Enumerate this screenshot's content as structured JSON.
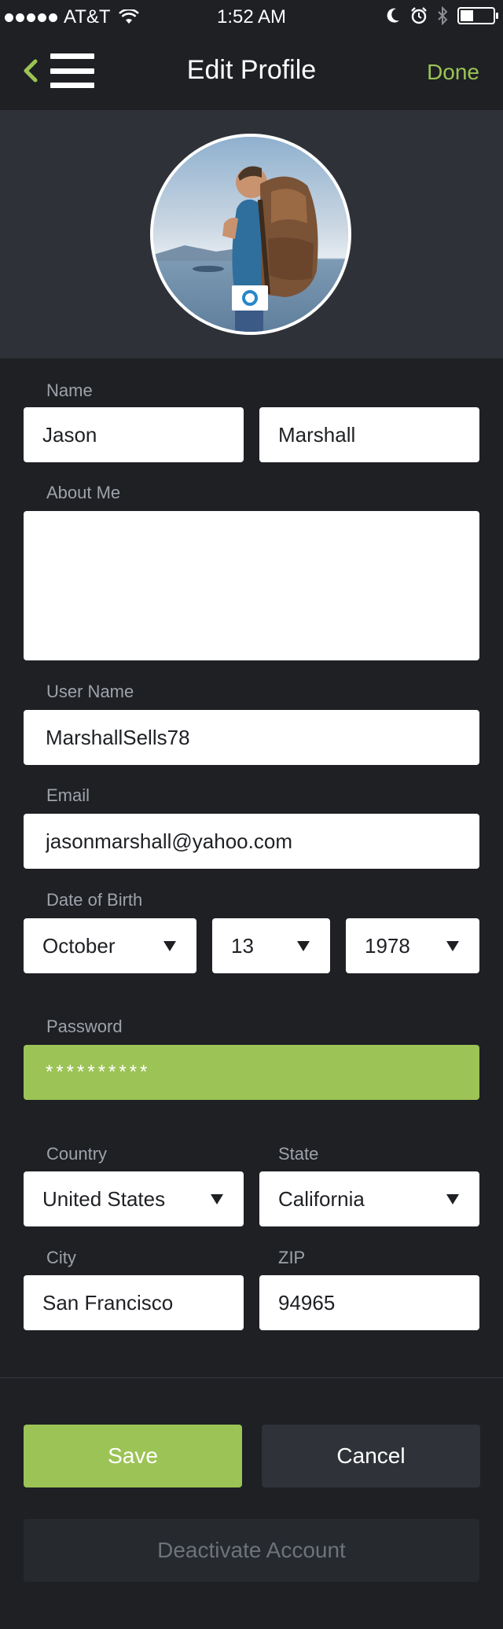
{
  "status_bar": {
    "carrier": "AT&T",
    "time": "1:52 AM"
  },
  "nav": {
    "title": "Edit Profile",
    "done_label": "Done"
  },
  "form": {
    "name_label": "Name",
    "first_name": "Jason",
    "last_name": "Marshall",
    "about_label": "About Me",
    "about_value": "",
    "username_label": "User Name",
    "username": "MarshallSells78",
    "email_label": "Email",
    "email": "jasonmarshall@yahoo.com",
    "dob_label": "Date of Birth",
    "dob_month": "October",
    "dob_day": "13",
    "dob_year": "1978",
    "password_label": "Password",
    "password_masked": "**********",
    "country_label": "Country",
    "country": "United States",
    "state_label": "State",
    "state": "California",
    "city_label": "City",
    "city": "San Francisco",
    "zip_label": "ZIP",
    "zip": "94965"
  },
  "actions": {
    "save_label": "Save",
    "cancel_label": "Cancel",
    "deactivate_label": "Deactivate Account"
  },
  "colors": {
    "accent": "#9cc355",
    "background": "#1e2024",
    "hero_background": "#2e3238"
  }
}
